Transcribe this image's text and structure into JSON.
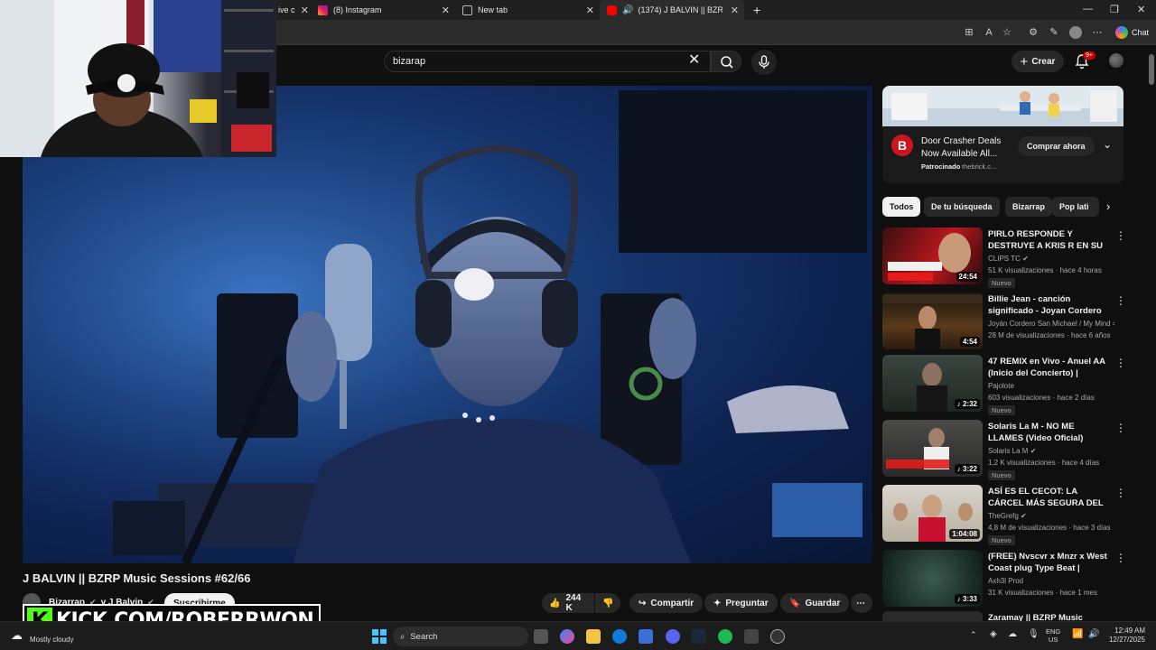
{
  "browser": {
    "tabs": [
      {
        "label": "ive c",
        "active": false
      },
      {
        "label": "(8) Instagram",
        "active": false
      },
      {
        "label": "New tab",
        "active": false
      },
      {
        "label": "(1374) J BALVIN || BZRP Music",
        "active": true
      }
    ],
    "chat_label": "Chat"
  },
  "youtube": {
    "search_value": "bizarap",
    "create_label": "Crear",
    "notification_count": "9+",
    "video": {
      "title": "J BALVIN || BZRP Music Sessions #62/66",
      "channel": "Bizarrap",
      "coauthor": "y J Balvin",
      "subscribe_label": "Suscribirme",
      "likes": "244 K",
      "share_label": "Compartir",
      "ask_label": "Preguntar",
      "save_label": "Guardar"
    },
    "ad": {
      "title": "Door Crasher Deals Now Available All...",
      "sponsored": "Patrocinado",
      "domain": "thebrick.c...",
      "cta": "Comprar ahora"
    },
    "chips": [
      "Todos",
      "De tu búsqueda",
      "Bizarrap",
      "Pop lati"
    ],
    "recommendations": [
      {
        "title": "PIRLO RESPONDE Y DESTRUYE A KRIS R EN SU TIRADERA ☠️...",
        "channel": "CLIPS TC",
        "verified": true,
        "stats": "51 K visualizaciones · hace 4 horas",
        "badge": "Nuevo",
        "duration": "24:54",
        "thumb": "a"
      },
      {
        "title": "Billie Jean - canción significado - Joyan Cordero",
        "channel": "Joyán Cordero San Michael / My Mind =...",
        "verified": false,
        "stats": "28 M de visualizaciones · hace 6 años",
        "badge": "",
        "duration": "4:54",
        "thumb": "b"
      },
      {
        "title": "47 REMIX en Vivo - Anuel AA (Inicio del Concierto) | Movista...",
        "channel": "Pajolote",
        "verified": false,
        "stats": "603 visualizaciones · hace 2 días",
        "badge": "Nuevo",
        "duration": "♪ 2:32",
        "thumb": "c"
      },
      {
        "title": "Solaris La M - NO ME LLAMES (Video Oficial)",
        "channel": "Solaris La M",
        "verified": true,
        "stats": "1,2 K visualizaciones · hace 4 días",
        "badge": "Nuevo",
        "duration": "♪ 3:22",
        "thumb": "d"
      },
      {
        "title": "ASÍ ES EL CECOT: LA CÁRCEL MÁS SEGURA DEL MUNDO",
        "channel": "TheGrefg",
        "verified": true,
        "stats": "4,8 M de visualizaciones · hace 3 días",
        "badge": "Nuevo",
        "duration": "1:04:08",
        "thumb": "e"
      },
      {
        "title": "(FREE) Nvscvr x Mnzr x West Coast plug Type Beat | \"Sola\" ...",
        "channel": "Axh3l Prod",
        "verified": false,
        "stats": "31 K visualizaciones · hace 1 mes",
        "badge": "",
        "duration": "♪ 3:33",
        "thumb": "f"
      },
      {
        "title": "Zaramay || BZRP Music",
        "channel": "",
        "verified": false,
        "stats": "",
        "badge": "",
        "duration": "",
        "thumb": "g"
      }
    ]
  },
  "overlay": {
    "kick_letter": "K",
    "kick_url": "KICK.COM/ROBERRWON"
  },
  "taskbar": {
    "weather": "Mostly cloudy",
    "search_label": "Search",
    "lang_top": "ENG",
    "lang_bottom": "US",
    "time": "12:49 AM",
    "date": "12/27/2025"
  }
}
